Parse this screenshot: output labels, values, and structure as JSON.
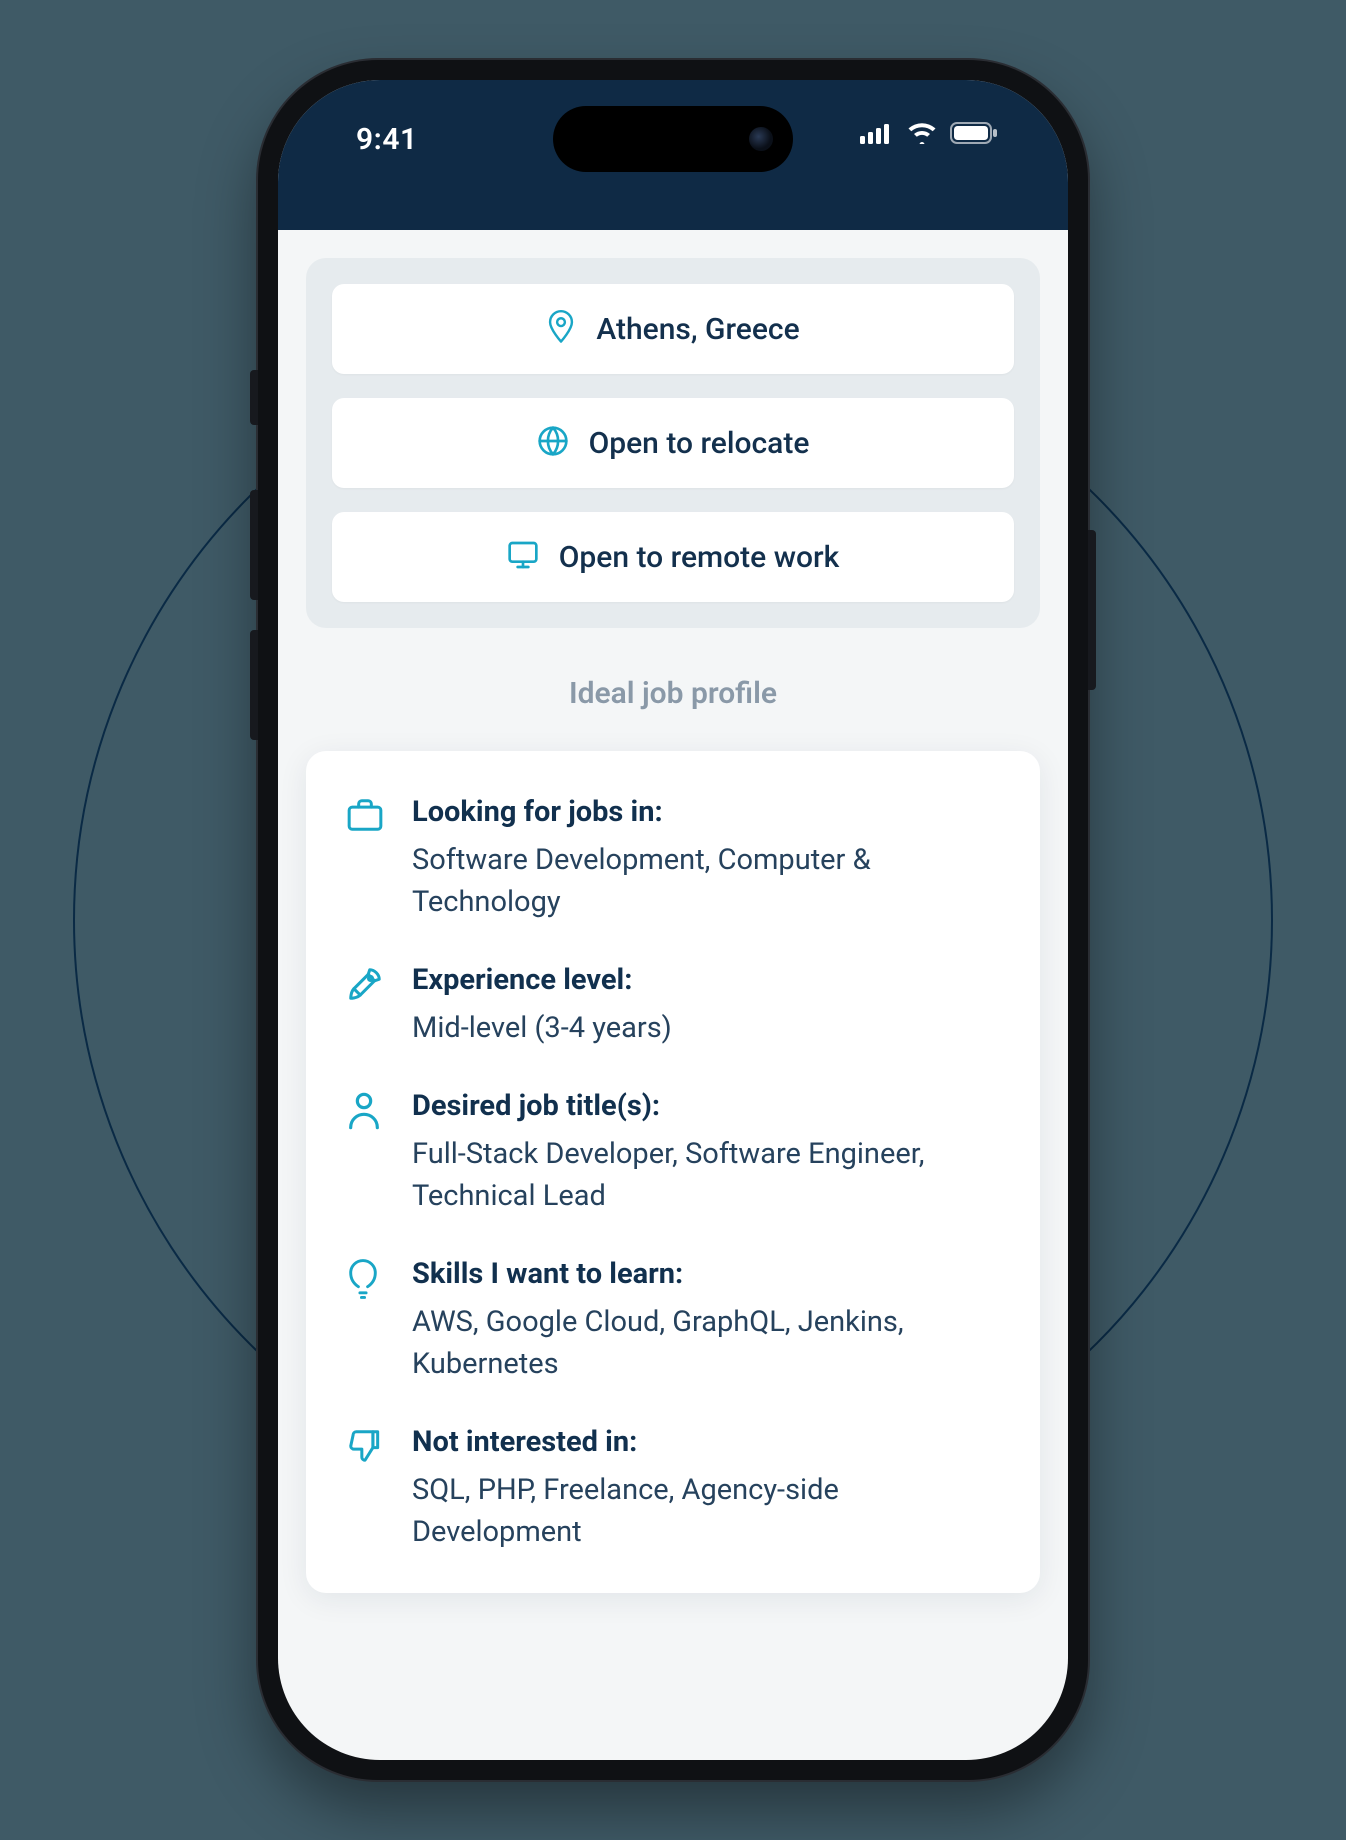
{
  "statusBar": {
    "time": "9:41"
  },
  "preferences": {
    "location": "Athens, Greece",
    "relocate": "Open to relocate",
    "remote": "Open to remote work"
  },
  "sectionTitle": "Ideal job profile",
  "profile": {
    "lookingFor": {
      "heading": "Looking for jobs in:",
      "body": "Software Development, Computer & Technology"
    },
    "experience": {
      "heading": "Experience level:",
      "body": "Mid-level (3-4 years)"
    },
    "titles": {
      "heading": "Desired job title(s):",
      "body": "Full-Stack Developer, Software Engineer, Technical Lead"
    },
    "skills": {
      "heading": "Skills I want to learn:",
      "body": "AWS, Google Cloud, GraphQL, Jenkins, Kubernetes"
    },
    "notInterested": {
      "heading": "Not interested in:",
      "body": "SQL, PHP, Freelance, Agency-side Development"
    }
  },
  "colors": {
    "accent": "#19a6c6",
    "darkNavy": "#0f2a45",
    "textPrimary": "#11304e",
    "background": "#3f5a66"
  }
}
